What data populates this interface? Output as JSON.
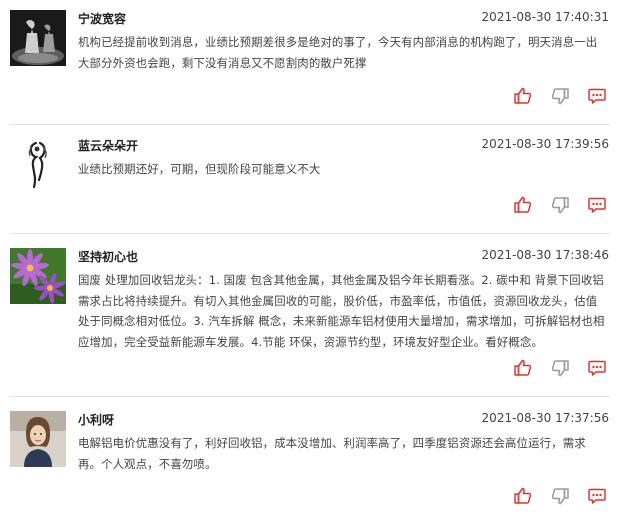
{
  "comments": [
    {
      "username": "宁波宽容",
      "timestamp": "2021-08-30 17:40:31",
      "text": "机构已经提前收到消息，业绩比预期差很多是绝对的事了，今天有内部消息的机构跑了，明天消息一出大部分外资也会跑，剩下没有消息又不愿割肉的散户死撑",
      "avatar_icon": "chess-pieces-avatar"
    },
    {
      "username": "蓝云朵朵开",
      "timestamp": "2021-08-30 17:39:56",
      "text": "业绩比预期还好，可期，但现阶段可能意义不大",
      "avatar_icon": "ink-figure-avatar"
    },
    {
      "username": "坚持初心也",
      "timestamp": "2021-08-30 17:38:46",
      "text": "国废 处理加回收铝龙头：1. 国废 包含其他金属，其他金属及铝今年长期看涨。2. 碳中和 背景下回收铝需求占比将持续提升。有切入其他金属回收的可能，股价低，市盈率低，市值低，资源回收龙头，估值处于同概念相对低位。3. 汽车拆解 概念，未来新能源车铝材使用大量增加，需求增加，可拆解铝材也相应增加，完全受益新能源车发展。4.节能 环保，资源节约型，环境友好型企业。看好概念。",
      "avatar_icon": "purple-flower-avatar"
    },
    {
      "username": "小利呀",
      "timestamp": "2021-08-30 17:37:56",
      "text": "电解铝电价优惠没有了，利好回收铝，成本没增加、利润率高了，四季度铝资源还会高位运行，需求再。个人观点，不喜勿喷。",
      "avatar_icon": "woman-portrait-avatar"
    }
  ],
  "icons": {
    "like": "thumbs-up-icon",
    "dislike": "thumbs-down-icon",
    "reply": "comment-icon"
  },
  "colors": {
    "like": "#e0352f",
    "dislike": "#9a9a9a",
    "reply": "#e0352f",
    "divider": "#e5e5e5"
  }
}
